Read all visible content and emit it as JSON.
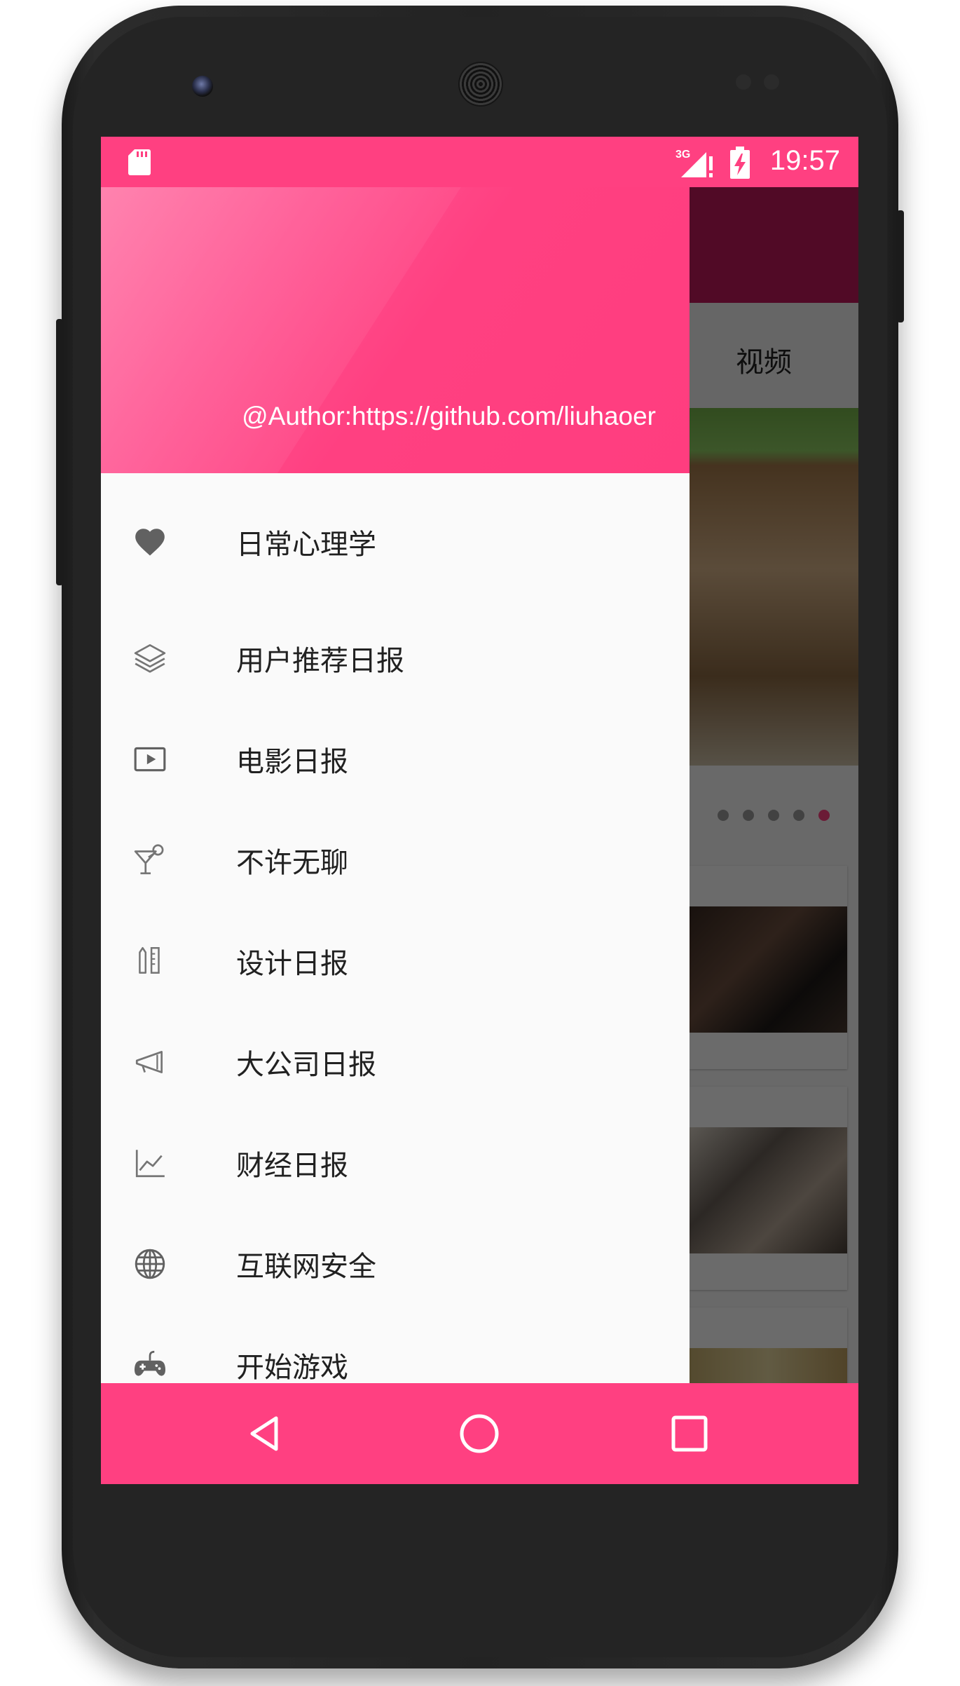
{
  "status_bar": {
    "time": "19:57",
    "network": "3G",
    "colors": {
      "background": "#ff4081",
      "text": "#ffffff"
    }
  },
  "background_app": {
    "visible_tab": "视频",
    "toolbar_color": "#c2185b",
    "banner_page_count": 5,
    "banner_active_page": 5
  },
  "drawer": {
    "header": {
      "author": "@Author:https://github.com/liuhaoer",
      "color": "#ff4081"
    },
    "menu": [
      {
        "label": "日常心理学",
        "icon": "heart-icon"
      },
      {
        "label": "用户推荐日报",
        "icon": "layers-icon"
      },
      {
        "label": "电影日报",
        "icon": "movie-icon"
      },
      {
        "label": "不许无聊",
        "icon": "cocktail-icon"
      },
      {
        "label": "设计日报",
        "icon": "design-icon"
      },
      {
        "label": "大公司日报",
        "icon": "megaphone-icon"
      },
      {
        "label": "财经日报",
        "icon": "chart-icon"
      },
      {
        "label": "互联网安全",
        "icon": "globe-icon"
      },
      {
        "label": "开始游戏",
        "icon": "gamepad-icon"
      }
    ]
  },
  "nav_bar": {
    "color": "#ff4081",
    "buttons": [
      "back-icon",
      "home-icon",
      "recents-icon"
    ]
  }
}
